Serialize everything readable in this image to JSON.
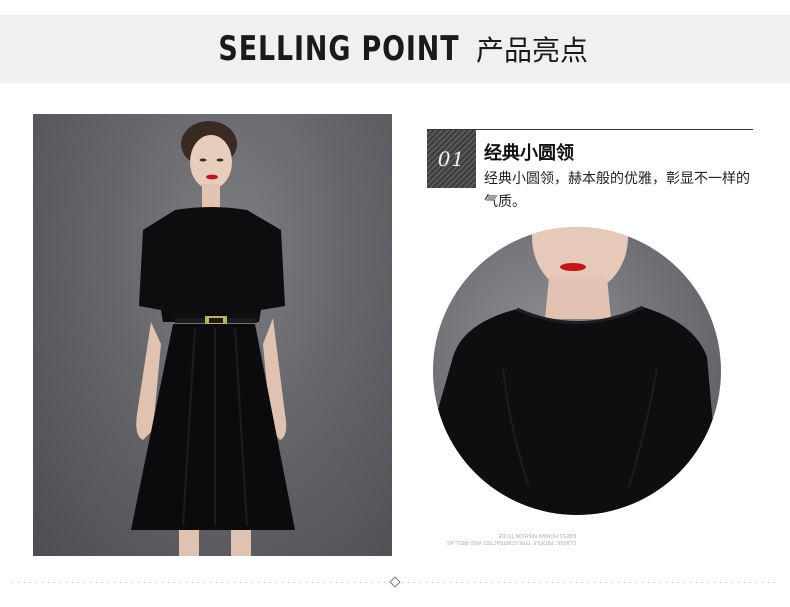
{
  "header": {
    "title_en": "SELLING POINT",
    "title_cn": "产品亮点"
  },
  "feature": {
    "number": "01",
    "title": "经典小圆领",
    "description": "经典小圆领，赫本般的优雅，彰显不一样的气质。"
  },
  "caption": {
    "line1": "CLASSIC PROFILE TYPE CONTRACTED AND WELL AS",
    "line2": "DRESS HUMAN FASHION TO DE"
  },
  "colors": {
    "header_band": "#f0f0f0",
    "text": "#1a1a1a",
    "dress": "#0d0d0f",
    "lips": "#c4151c"
  }
}
